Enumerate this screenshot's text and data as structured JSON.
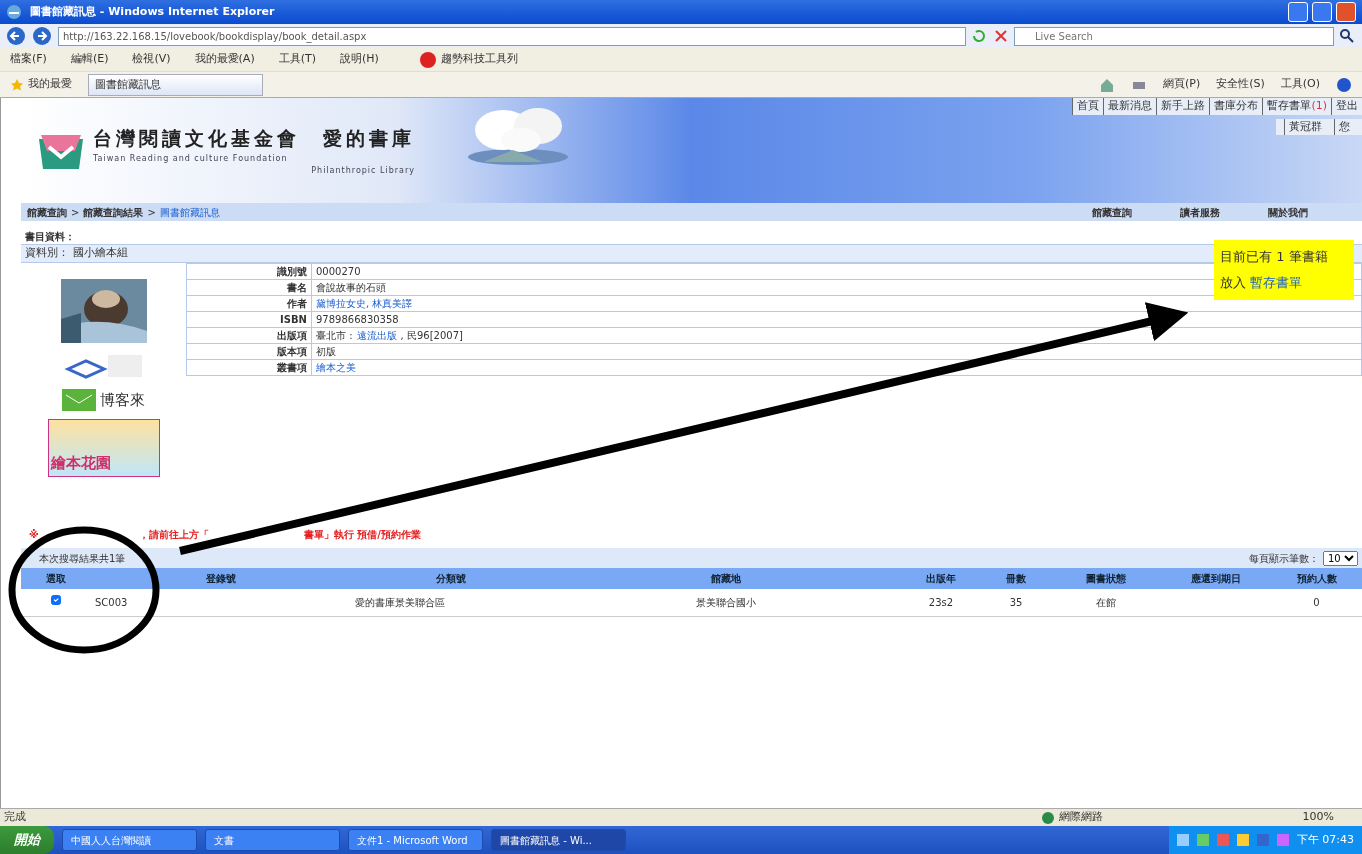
{
  "window": {
    "title": "圖書館藏訊息 - Windows Internet Explorer"
  },
  "address_bar": {
    "url": "http://163.22.168.15/lovebook/bookdisplay/book_detail.aspx",
    "search_placeholder": "Live Search"
  },
  "menu": [
    "檔案(F)",
    "編輯(E)",
    "檢視(V)",
    "我的最愛(A)",
    "工具(T)",
    "說明(H)"
  ],
  "toolbar_addon": "趨勢科技工具列",
  "favorites": {
    "label": "我的最愛",
    "tab": "圖書館藏訊息"
  },
  "command_bar": [
    "網頁(P)",
    "安全性(S)",
    "工具(O)"
  ],
  "site": {
    "title": "台灣閱讀文化基金會　愛的書庫",
    "subtitle": "Taiwan Reading and culture Foundation",
    "subtitle2": "Philanthropic Library",
    "top_links": [
      {
        "label": "首頁"
      },
      {
        "label": "最新消息"
      },
      {
        "label": "新手上路"
      },
      {
        "label": "書庫分布"
      },
      {
        "label": "暫存書單",
        "count": "(1)"
      },
      {
        "label": "登出"
      }
    ],
    "user": "黃冠群",
    "greeting": "您",
    "breadcrumb_separator": ">",
    "breadcrumb": [
      {
        "label": "館藏查詢",
        "current": false
      },
      {
        "label": "館藏查詢結果",
        "current": false
      },
      {
        "label": "圖書館藏訊息",
        "current": true
      }
    ],
    "nav": [
      "館藏查詢",
      "讀者服務",
      "關於我們"
    ]
  },
  "record": {
    "heading": "書目資料：",
    "type_label": "資料別：",
    "type_value": "國小繪本組",
    "fields": [
      {
        "label": "識別號",
        "value": "0000270",
        "link": false
      },
      {
        "label": "書名",
        "value": "會說故事的石頭",
        "link": false
      },
      {
        "label": "作者",
        "value": "黛博拉女史, 林真美譯",
        "link": true
      },
      {
        "label": "ISBN",
        "value": "9789866830358",
        "link": false
      },
      {
        "label": "出版項",
        "prefix": "臺北市 :",
        "value": "遠流出版",
        "suffix": ", 民96[2007]",
        "link": true
      },
      {
        "label": "版本項",
        "value": "初版",
        "link": false
      },
      {
        "label": "叢書項",
        "value": "繪本之美",
        "link": true
      }
    ],
    "links": {
      "bookstore": "博客來",
      "garden": "繪本花園"
    }
  },
  "cart_notice": {
    "line1": "目前已有 1 筆書籍",
    "line2": "放入",
    "link": "暫存書單"
  },
  "notice": [
    "※",
    "，請前往上方「",
    "書單」執行 預借/預約作業"
  ],
  "holdings": {
    "summary": "本次搜尋結果共1筆",
    "page_size_label": "每頁顯示筆數：",
    "page_size": "10",
    "select_column": "選取",
    "columns": [
      "登錄號",
      "分類號",
      "館藏地",
      "出版年",
      "冊數",
      "圖書狀態",
      "應還到期日",
      "預約人數"
    ],
    "rows": [
      {
        "checked": true,
        "cells": [
          "SC003",
          "愛的書庫景美聯合區",
          "景美聯合國小",
          "23s2",
          "35",
          "在館",
          "",
          "0"
        ]
      }
    ]
  },
  "status_bar": {
    "text": "完成",
    "zone": "網際網路",
    "zoom": "100%"
  },
  "taskbar": {
    "start": "開始",
    "tasks": [
      {
        "label": "中國人人台灣閱讀",
        "active": false
      },
      {
        "label": "文書",
        "active": false
      },
      {
        "label": "文件1 - Microsoft Word",
        "active": false
      },
      {
        "label": "圖書館藏訊息 - Wi...",
        "active": true
      }
    ],
    "clock": "下午 07:43"
  }
}
